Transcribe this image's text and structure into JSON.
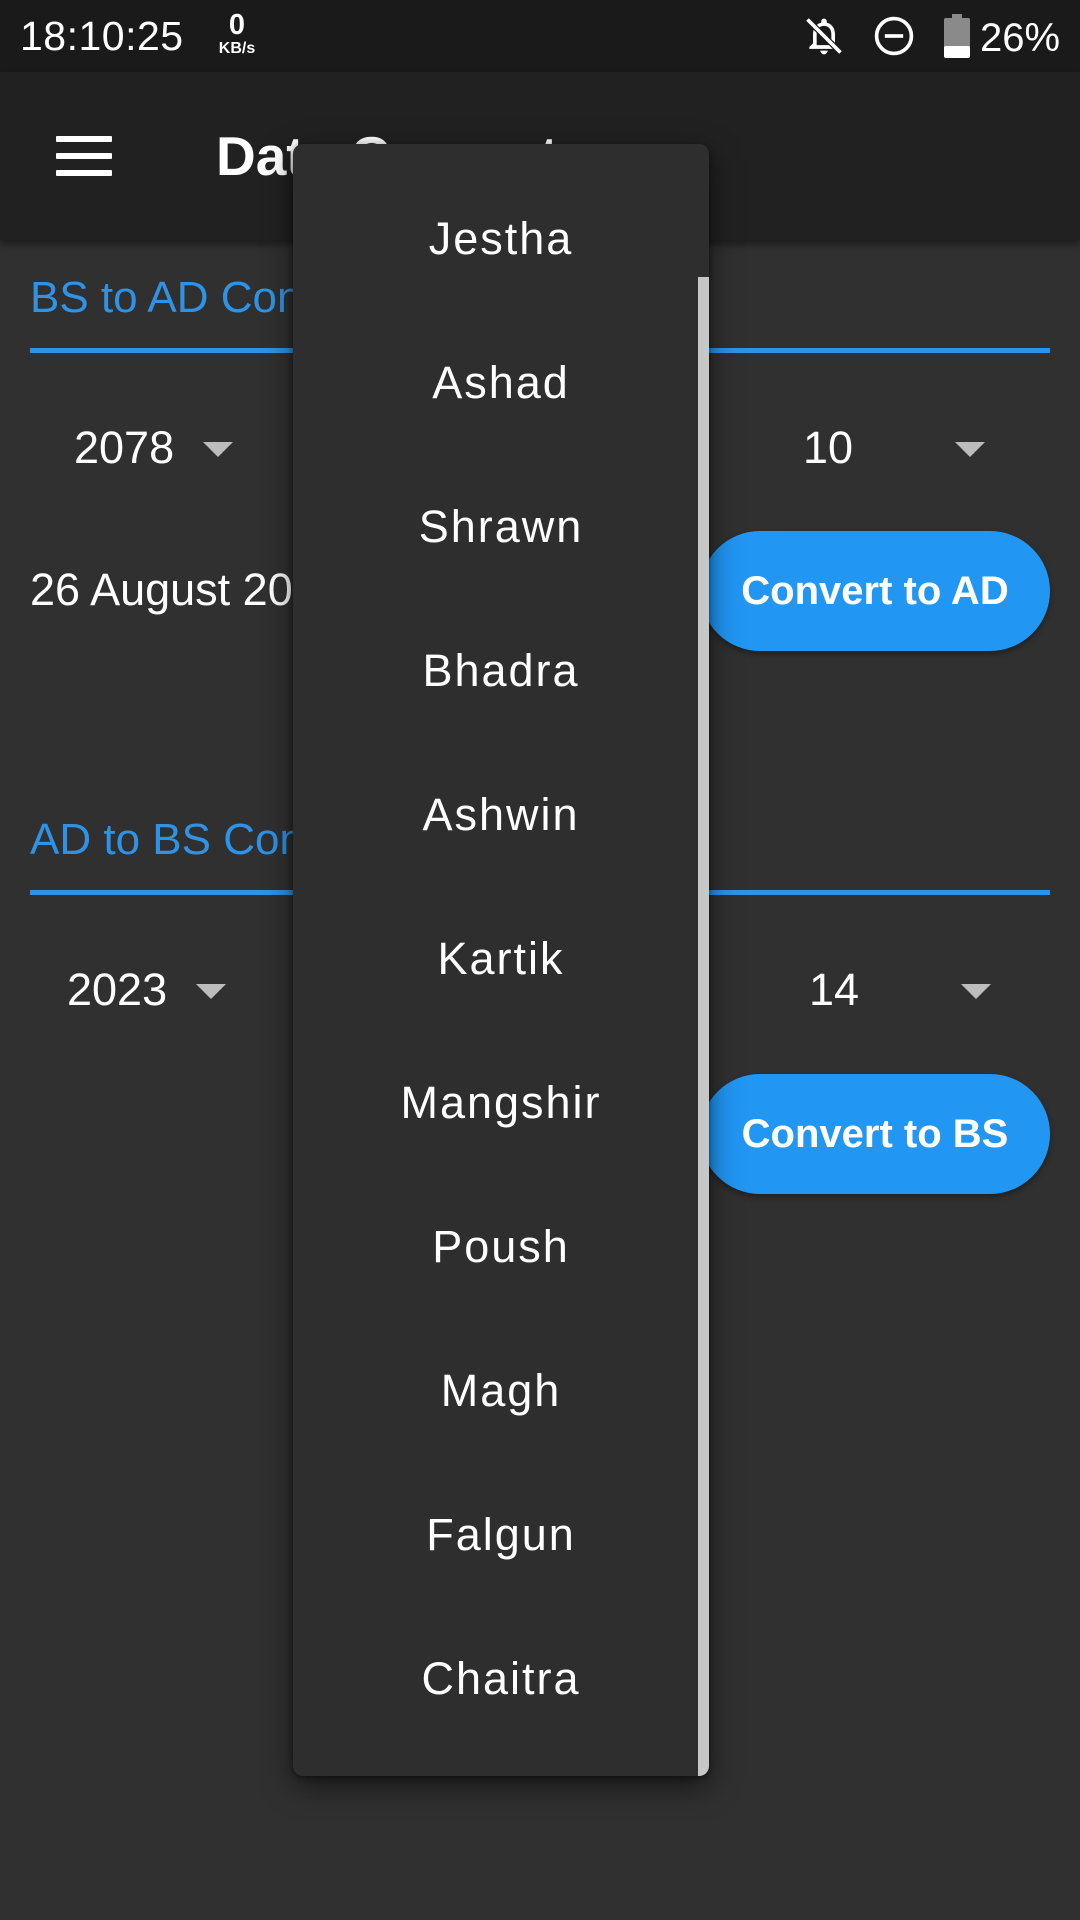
{
  "status_bar": {
    "time": "18:10:25",
    "net_speed_value": "0",
    "net_speed_unit": "KB/s",
    "battery_percent": "26%",
    "icons": [
      "bell-off-icon",
      "do-not-disturb-icon",
      "battery-icon"
    ]
  },
  "app_bar": {
    "title": "Date Converter",
    "menu_icon": "hamburger-menu-icon"
  },
  "bs_to_ad": {
    "title": "BS to AD Conversion",
    "year": "2078",
    "day": "10",
    "result": "26 August 2021",
    "button_label": "Convert to AD"
  },
  "ad_to_bs": {
    "title": "AD to BS Conversion",
    "year": "2023",
    "day": "14",
    "button_label": "Convert to BS"
  },
  "month_menu": {
    "items": [
      {
        "label": "Jestha"
      },
      {
        "label": "Ashad"
      },
      {
        "label": "Shrawn"
      },
      {
        "label": "Bhadra"
      },
      {
        "label": "Ashwin"
      },
      {
        "label": "Kartik"
      },
      {
        "label": "Mangshir"
      },
      {
        "label": "Poush"
      },
      {
        "label": "Magh"
      },
      {
        "label": "Falgun"
      },
      {
        "label": "Chaitra"
      }
    ]
  },
  "colors": {
    "accent": "#2196f3",
    "section_text": "#2e93e6",
    "background": "#303030",
    "app_bar": "#212121",
    "status_bar": "#1a1a1a",
    "menu_background": "#2e2e2e"
  }
}
